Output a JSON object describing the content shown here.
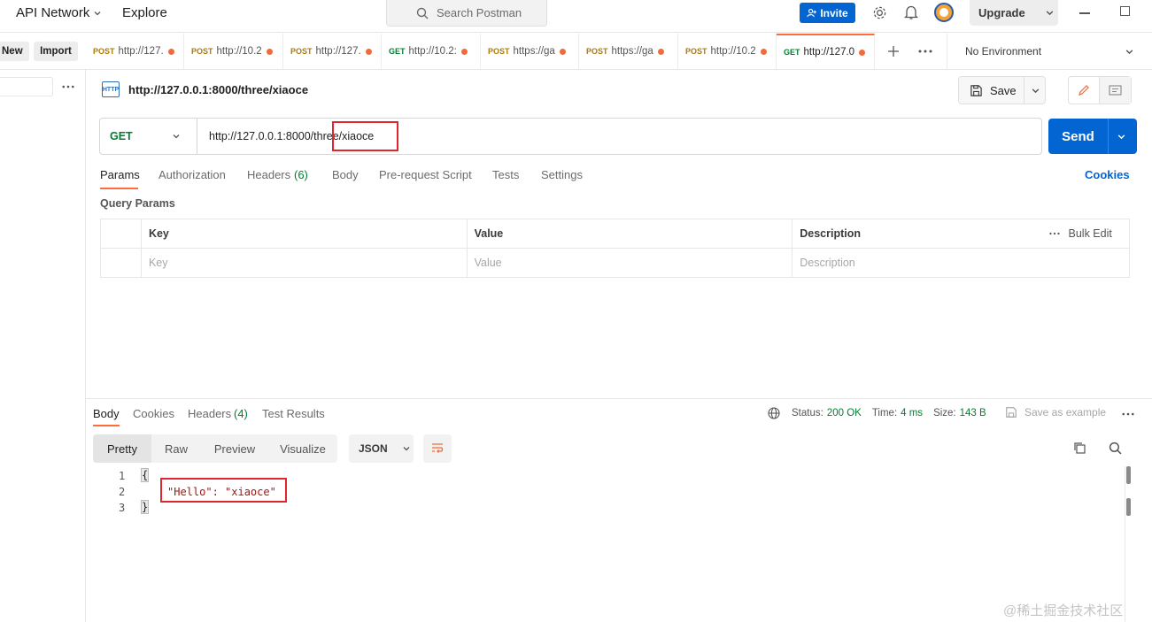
{
  "topbar": {
    "api_network": "API Network",
    "explore": "Explore",
    "search_placeholder": "Search Postman",
    "invite": "Invite",
    "upgrade": "Upgrade"
  },
  "sidebar": {
    "new": "New",
    "import": "Import"
  },
  "tabs": [
    {
      "method": "POST",
      "url": "http://127.",
      "active": false
    },
    {
      "method": "POST",
      "url": "http://10.2",
      "active": false
    },
    {
      "method": "POST",
      "url": "http://127.",
      "active": false
    },
    {
      "method": "GET",
      "url": "http://10.2:",
      "active": false
    },
    {
      "method": "POST",
      "url": "https://ga",
      "active": false
    },
    {
      "method": "POST",
      "url": "https://ga",
      "active": false
    },
    {
      "method": "POST",
      "url": "http://10.2",
      "active": false
    },
    {
      "method": "GET",
      "url": "http://127.0",
      "active": true
    }
  ],
  "environment": "No Environment",
  "request": {
    "title": "http://127.0.0.1:8000/three/xiaoce",
    "save": "Save",
    "method": "GET",
    "url": "http://127.0.0.1:8000/three/xiaoce",
    "send": "Send"
  },
  "request_tabs": {
    "params": "Params",
    "authorization": "Authorization",
    "headers": "Headers",
    "headers_count": "(6)",
    "body": "Body",
    "prerequest": "Pre-request Script",
    "tests": "Tests",
    "settings": "Settings",
    "cookies": "Cookies"
  },
  "query_params": {
    "title": "Query Params",
    "columns": [
      "Key",
      "Value",
      "Description"
    ],
    "bulk_edit": "Bulk Edit",
    "placeholders": [
      "Key",
      "Value",
      "Description"
    ]
  },
  "response": {
    "tabs": {
      "body": "Body",
      "cookies": "Cookies",
      "headers": "Headers",
      "headers_count": "(4)",
      "test_results": "Test Results"
    },
    "status_label": "Status:",
    "status_value": "200 OK",
    "time_label": "Time:",
    "time_value": "4 ms",
    "size_label": "Size:",
    "size_value": "143 B",
    "save_example": "Save as example",
    "views": [
      "Pretty",
      "Raw",
      "Preview",
      "Visualize"
    ],
    "format": "JSON",
    "lines": [
      {
        "n": "1",
        "text": "{"
      },
      {
        "n": "2",
        "text": "\"Hello\": \"xiaoce\""
      },
      {
        "n": "3",
        "text": "}"
      }
    ]
  },
  "watermark": "@稀土掘金技术社区",
  "colors": {
    "accent": "#ff6c37",
    "primary": "#0265d2",
    "status_ok": "#007f31",
    "highlight_box": "#e0262e"
  }
}
